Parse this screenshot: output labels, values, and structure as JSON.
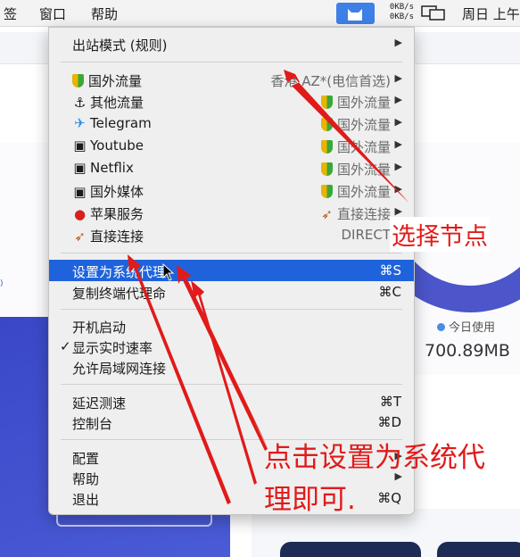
{
  "menubar": {
    "items": [
      "签",
      "窗口",
      "帮助"
    ],
    "speed_up": "0KB/s",
    "speed_down": "0KB/s",
    "clock": "周日 上午"
  },
  "background": {
    "today_label": "今日使用",
    "today_value": "700.89MB",
    "left_text": ")"
  },
  "menu": {
    "outbound": {
      "label": "出站模式 (规则)"
    },
    "proxies": [
      {
        "icon": "shield-icon",
        "label": "国外流量",
        "value": "香港 AZ*(电信首选)"
      },
      {
        "icon": "anchor-icon",
        "label": "其他流量",
        "value": "国外流量"
      },
      {
        "icon": "airplane-icon",
        "label": "Telegram",
        "value": "国外流量"
      },
      {
        "icon": "clapper-icon",
        "label": "Youtube",
        "value": "国外流量"
      },
      {
        "icon": "clapper-icon",
        "label": "Netflix",
        "value": "国外流量"
      },
      {
        "icon": "clapper-icon",
        "label": "国外媒体",
        "value": "国外流量"
      },
      {
        "icon": "apple-icon",
        "label": "苹果服务",
        "value": "直接连接"
      },
      {
        "icon": "rocket-icon",
        "label": "直接连接",
        "value": "DIRECT"
      }
    ],
    "set_system_proxy": {
      "label": "设置为系统代理",
      "shortcut": "⌘S"
    },
    "copy_terminal_proxy": {
      "label": "复制终端代理命",
      "shortcut": "⌘C"
    },
    "launch_at_login": {
      "label": "开机启动"
    },
    "show_speed": {
      "check": "✓",
      "label": "显示实时速率"
    },
    "allow_lan": {
      "label": "允许局域网连接"
    },
    "latency_test": {
      "label": "延迟测速",
      "shortcut": "⌘T"
    },
    "dashboard": {
      "label": "控制台",
      "shortcut": "⌘D"
    },
    "config": {
      "label": "配置"
    },
    "help": {
      "label": "帮助"
    },
    "quit": {
      "label": "退出",
      "shortcut": "⌘Q"
    },
    "submenu_arrow": "▶"
  },
  "annotations": {
    "select_node": "选择节点",
    "click_line1": "点击设置为系统代",
    "click_line2": "理即可."
  },
  "colors": {
    "highlight": "#1f63dc",
    "annotation": "#e11a1a",
    "menubar_app": "#3f7fe8"
  }
}
